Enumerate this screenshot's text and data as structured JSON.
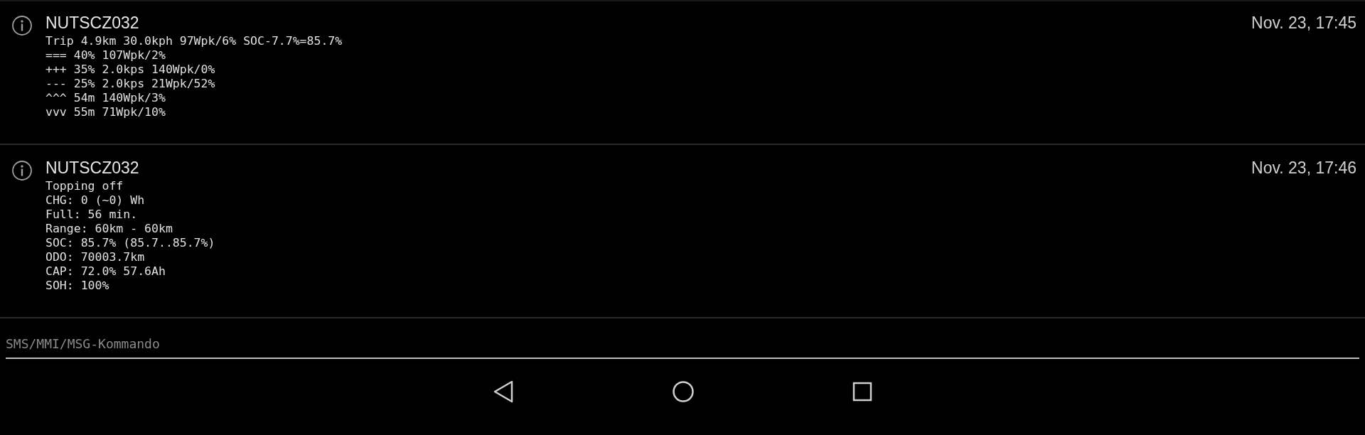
{
  "messages": [
    {
      "sender": "NUTSCZ032",
      "time": "Nov. 23, 17:45",
      "lines": [
        "Trip 4.9km 30.0kph 97Wpk/6% SOC-7.7%=85.7%",
        "=== 40% 107Wpk/2%",
        "+++ 35% 2.0kps 140Wpk/0%",
        "--- 25% 2.0kps 21Wpk/52%",
        "^^^ 54m 140Wpk/3%",
        "vvv 55m 71Wpk/10%"
      ]
    },
    {
      "sender": "NUTSCZ032",
      "time": "Nov. 23, 17:46",
      "lines": [
        "Topping off",
        "CHG: 0 (~0) Wh",
        "Full: 56 min.",
        "Range: 60km - 60km",
        "SOC: 85.7% (85.7..85.7%)",
        "ODO: 70003.7km",
        "CAP: 72.0% 57.6Ah",
        "SOH: 100%"
      ]
    }
  ],
  "command": {
    "placeholder": "SMS/MMI/MSG-Kommando"
  }
}
